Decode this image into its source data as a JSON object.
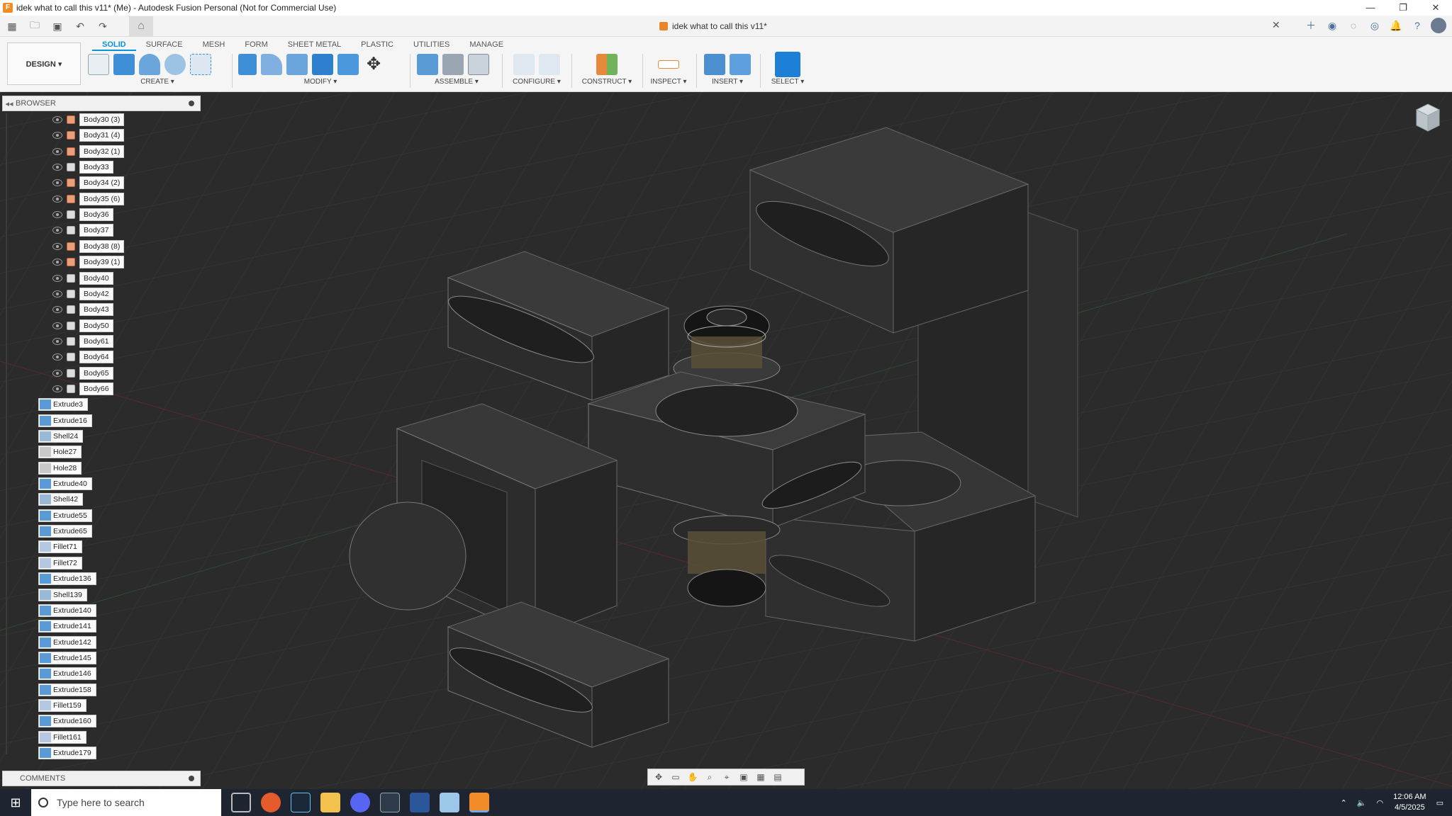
{
  "window": {
    "title": "idek what to call this v11* (Me) - Autodesk Fusion Personal (Not for Commercial Use)",
    "controls": [
      "—",
      "❐",
      "✕"
    ]
  },
  "doc_tab": {
    "title": "idek what to call this v11*",
    "close": "✕"
  },
  "workspace": {
    "label": "DESIGN ▾"
  },
  "tabs": [
    "SOLID",
    "SURFACE",
    "MESH",
    "FORM",
    "SHEET METAL",
    "PLASTIC",
    "UTILITIES",
    "MANAGE"
  ],
  "tool_groups": {
    "create": "CREATE ▾",
    "modify": "MODIFY ▾",
    "assemble": "ASSEMBLE ▾",
    "configure": "CONFIGURE ▾",
    "construct": "CONSTRUCT ▾",
    "inspect": "INSPECT ▾",
    "insert": "INSERT ▾",
    "select": "SELECT ▾"
  },
  "browser": {
    "title": "BROWSER",
    "bodies": [
      {
        "label": "Body30 (3)",
        "comp": true
      },
      {
        "label": "Body31 (4)",
        "comp": true
      },
      {
        "label": "Body32 (1)",
        "comp": true
      },
      {
        "label": "Body33",
        "comp": false
      },
      {
        "label": "Body34 (2)",
        "comp": true
      },
      {
        "label": "Body35 (6)",
        "comp": true
      },
      {
        "label": "Body36",
        "comp": false
      },
      {
        "label": "Body37",
        "comp": false
      },
      {
        "label": "Body38 (8)",
        "comp": true
      },
      {
        "label": "Body39 (1)",
        "comp": true
      },
      {
        "label": "Body40",
        "comp": false
      },
      {
        "label": "Body42",
        "comp": false
      },
      {
        "label": "Body43",
        "comp": false
      },
      {
        "label": "Body50",
        "comp": false
      },
      {
        "label": "Body61",
        "comp": false
      },
      {
        "label": "Body64",
        "comp": false
      },
      {
        "label": "Body65",
        "comp": false
      },
      {
        "label": "Body66",
        "comp": false
      }
    ],
    "features": [
      {
        "label": "Extrude3",
        "kind": "extrude"
      },
      {
        "label": "Extrude16",
        "kind": "extrude"
      },
      {
        "label": "Shell24",
        "kind": "shell"
      },
      {
        "label": "Hole27",
        "kind": "hole"
      },
      {
        "label": "Hole28",
        "kind": "hole"
      },
      {
        "label": "Extrude40",
        "kind": "extrude"
      },
      {
        "label": "Shell42",
        "kind": "shell"
      },
      {
        "label": "Extrude55",
        "kind": "extrude"
      },
      {
        "label": "Extrude65",
        "kind": "extrude"
      },
      {
        "label": "Fillet71",
        "kind": "fillet"
      },
      {
        "label": "Fillet72",
        "kind": "fillet"
      },
      {
        "label": "Extrude136",
        "kind": "extrude"
      },
      {
        "label": "Shell139",
        "kind": "shell"
      },
      {
        "label": "Extrude140",
        "kind": "extrude"
      },
      {
        "label": "Extrude141",
        "kind": "extrude"
      },
      {
        "label": "Extrude142",
        "kind": "extrude"
      },
      {
        "label": "Extrude145",
        "kind": "extrude"
      },
      {
        "label": "Extrude146",
        "kind": "extrude"
      },
      {
        "label": "Extrude158",
        "kind": "extrude"
      },
      {
        "label": "Fillet159",
        "kind": "fillet"
      },
      {
        "label": "Extrude160",
        "kind": "extrude"
      },
      {
        "label": "Fillet161",
        "kind": "fillet"
      },
      {
        "label": "Extrude179",
        "kind": "extrude"
      }
    ]
  },
  "comments": {
    "title": "COMMENTS"
  },
  "taskbar": {
    "search_placeholder": "Type here to search",
    "time": "12:06 AM",
    "date": "4/5/2025"
  }
}
